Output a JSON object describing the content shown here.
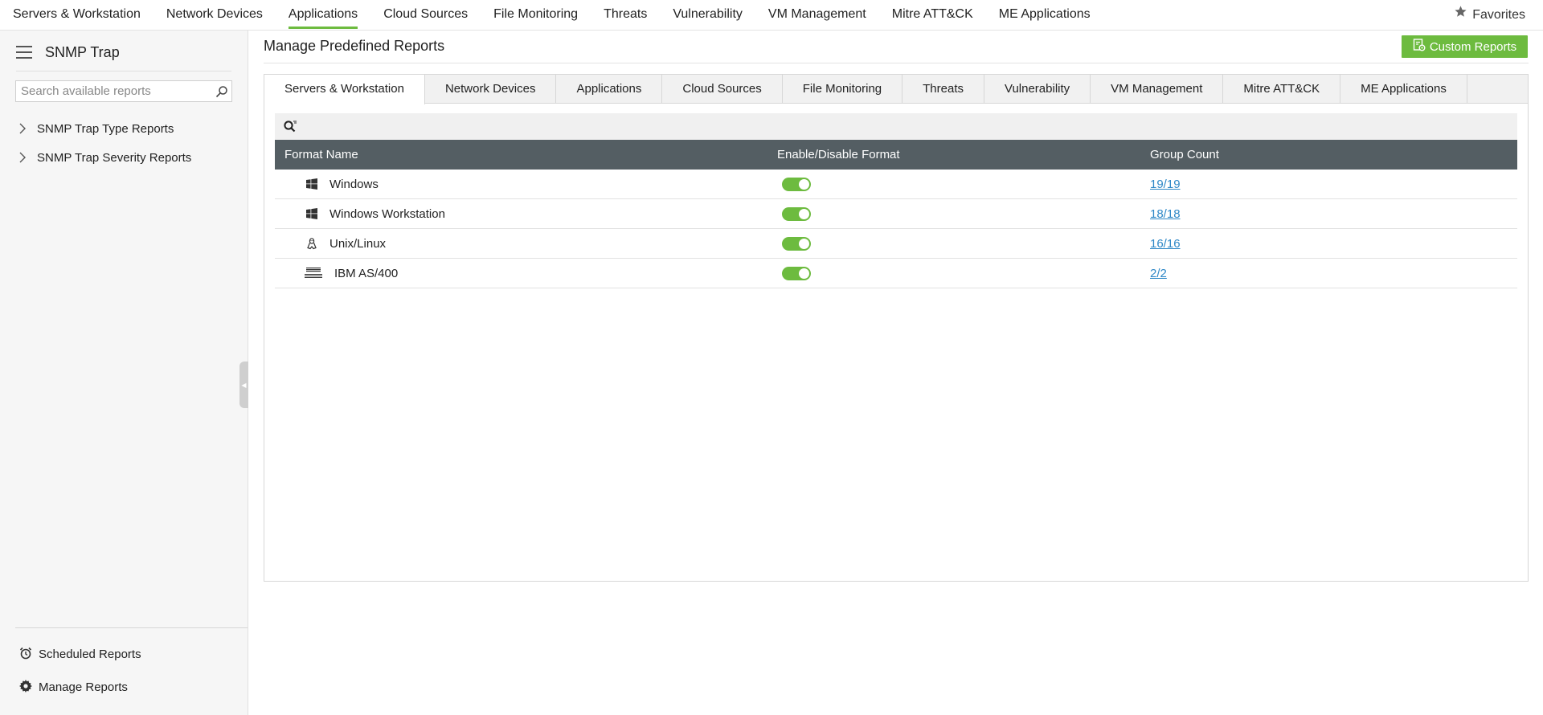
{
  "topnav": {
    "items": [
      "Servers & Workstation",
      "Network Devices",
      "Applications",
      "Cloud Sources",
      "File Monitoring",
      "Threats",
      "Vulnerability",
      "VM Management",
      "Mitre ATT&CK",
      "ME Applications"
    ],
    "active_index": 2,
    "favorites_label": "Favorites"
  },
  "sidebar": {
    "title": "SNMP Trap",
    "search_placeholder": "Search available reports",
    "tree": [
      {
        "label": "SNMP Trap Type Reports"
      },
      {
        "label": "SNMP Trap Severity Reports"
      }
    ],
    "bottom": {
      "scheduled_label": "Scheduled Reports",
      "manage_label": "Manage Reports"
    }
  },
  "main": {
    "title": "Manage Predefined Reports",
    "custom_reports_label": "Custom Reports",
    "tabs": [
      "Servers & Workstation",
      "Network Devices",
      "Applications",
      "Cloud Sources",
      "File Monitoring",
      "Threats",
      "Vulnerability",
      "VM Management",
      "Mitre ATT&CK",
      "ME Applications"
    ],
    "active_tab_index": 0,
    "table": {
      "headers": [
        "Format Name",
        "Enable/Disable Format",
        "Group Count"
      ],
      "rows": [
        {
          "icon": "windows-icon",
          "name": "Windows",
          "enabled": true,
          "group_count": "19/19"
        },
        {
          "icon": "windows-icon",
          "name": "Windows Workstation",
          "enabled": true,
          "group_count": "18/18"
        },
        {
          "icon": "linux-icon",
          "name": "Unix/Linux",
          "enabled": true,
          "group_count": "16/16"
        },
        {
          "icon": "ibm-as400-icon",
          "name": "IBM AS/400",
          "enabled": true,
          "group_count": "2/2"
        }
      ]
    }
  },
  "colors": {
    "accent": "#6dbb3f",
    "table_header_bg": "#545e63",
    "link": "#2f88c7"
  }
}
